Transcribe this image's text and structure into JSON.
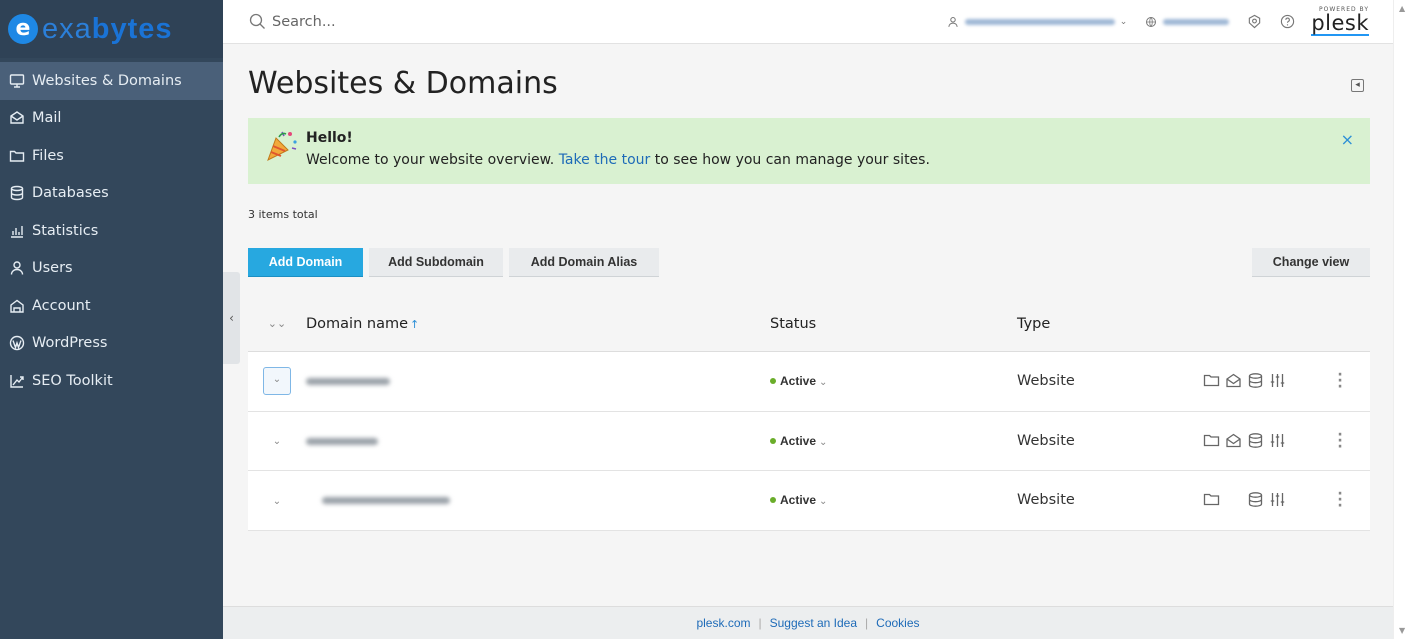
{
  "brand": {
    "logo_letter": "e",
    "logo_text_a": "exa",
    "logo_text_b": "bytes"
  },
  "sidebar": {
    "items": [
      {
        "label": "Websites & Domains",
        "icon": "monitor-icon",
        "active": true
      },
      {
        "label": "Mail",
        "icon": "mail-icon"
      },
      {
        "label": "Files",
        "icon": "folder-icon"
      },
      {
        "label": "Databases",
        "icon": "database-icon"
      },
      {
        "label": "Statistics",
        "icon": "bar-chart-icon"
      },
      {
        "label": "Users",
        "icon": "user-icon"
      },
      {
        "label": "Account",
        "icon": "account-icon"
      },
      {
        "label": "WordPress",
        "icon": "wordpress-icon"
      },
      {
        "label": "SEO Toolkit",
        "icon": "seo-chart-icon"
      }
    ],
    "collapse_glyph": "‹"
  },
  "header": {
    "search_placeholder": "Search...",
    "powered_by": "POWERED BY",
    "plesk": "plesk"
  },
  "main": {
    "title": "Websites & Domains",
    "welcome": {
      "title": "Hello!",
      "body_before": "Welcome to your website overview.",
      "link": "Take the tour",
      "body_after": "to see how you can manage your sites.",
      "close": "×"
    },
    "items_total": "3 items total",
    "toolbar": {
      "add_domain": "Add Domain",
      "add_subdomain": "Add Subdomain",
      "add_domain_alias": "Add Domain Alias",
      "change_view": "Change view"
    },
    "table": {
      "columns": {
        "name": "Domain name",
        "sort": "↑",
        "status": "Status",
        "type": "Type"
      },
      "rows": [
        {
          "status": "Active",
          "type": "Website"
        },
        {
          "status": "Active",
          "type": "Website"
        },
        {
          "status": "Active",
          "type": "Website"
        }
      ]
    }
  },
  "footer": {
    "links": [
      "plesk.com",
      "Suggest an Idea",
      "Cookies"
    ]
  },
  "colors": {
    "sidebar_bg": "#33475b",
    "accent": "#27a8e0",
    "welcome_bg": "#d9f1d1",
    "status_active": "#6aad2a"
  }
}
